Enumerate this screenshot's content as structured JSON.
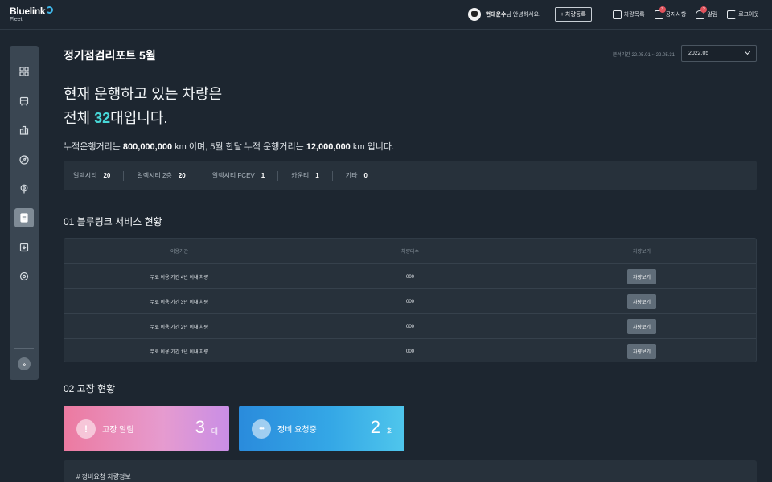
{
  "header": {
    "brand": "Bluelink",
    "brand_sub": "Fleet",
    "user_name": "현대운수",
    "greeting_suffix": "님 안녕하세요.",
    "register_button": "+ 차량등록",
    "items": [
      {
        "label": "차량목록",
        "icon": "vehicle-list-icon",
        "badge": ""
      },
      {
        "label": "공지사항",
        "icon": "megaphone-icon",
        "badge": "3"
      },
      {
        "label": "알림",
        "icon": "bell-icon",
        "badge": "2"
      },
      {
        "label": "로그아웃",
        "icon": "logout-icon",
        "badge": ""
      }
    ]
  },
  "sidebar": {
    "items": [
      "dashboard-icon",
      "bus-icon",
      "building-icon",
      "compass-icon",
      "location-icon",
      "report-icon",
      "download-icon",
      "settings-icon"
    ],
    "active": "report-icon",
    "expand_label": "»"
  },
  "report": {
    "title": "정기점검리포트 5월",
    "period_label": "분석기간 22.05.01 ~ 22.05.31",
    "month_selected": "2022.05",
    "headline_line1": "현재 운행하고 있는 차량은",
    "headline_pre": "전체 ",
    "headline_count": "32",
    "headline_post": "대입니다.",
    "summary_pre": "누적운행거리는 ",
    "summary_total": "800,000,000",
    "summary_mid": " km 이며, 5월 한달 누적 운행거리는 ",
    "summary_month": "12,000,000",
    "summary_post": " km 입니다."
  },
  "vehicle_types": [
    {
      "label": "일렉시티",
      "count": "20"
    },
    {
      "label": "일렉시티 2층",
      "count": "20"
    },
    {
      "label": "일렉시티 FCEV",
      "count": "1"
    },
    {
      "label": "카운티",
      "count": "1"
    },
    {
      "label": "기타",
      "count": "0"
    }
  ],
  "section1": {
    "title": "01 블루링크 서비스 현황",
    "headers": [
      "이용기간",
      "차량대수",
      "차량보기"
    ],
    "rows": [
      {
        "period": "무료 이용 기간 4년 이내 차량",
        "count": "000",
        "button": "차량보기"
      },
      {
        "period": "무료 이용 기간 3년 이내 차량",
        "count": "000",
        "button": "차량보기"
      },
      {
        "period": "무료 이용 기간 2년 이내 차량",
        "count": "000",
        "button": "차량보기"
      },
      {
        "period": "무료 이용 기간 1년 이내 차량",
        "count": "000",
        "button": "차량보기"
      }
    ]
  },
  "section2": {
    "title": "02 고장 현황",
    "cards": [
      {
        "label": "고장 알림",
        "value": "3",
        "unit": "대",
        "icon": "alert-icon",
        "icon_glyph": "!"
      },
      {
        "label": "정비 요청중",
        "value": "2",
        "unit": "회",
        "icon": "dots-icon",
        "icon_glyph": "•••"
      }
    ],
    "info_title": "# 정비요청 차량정보"
  }
}
